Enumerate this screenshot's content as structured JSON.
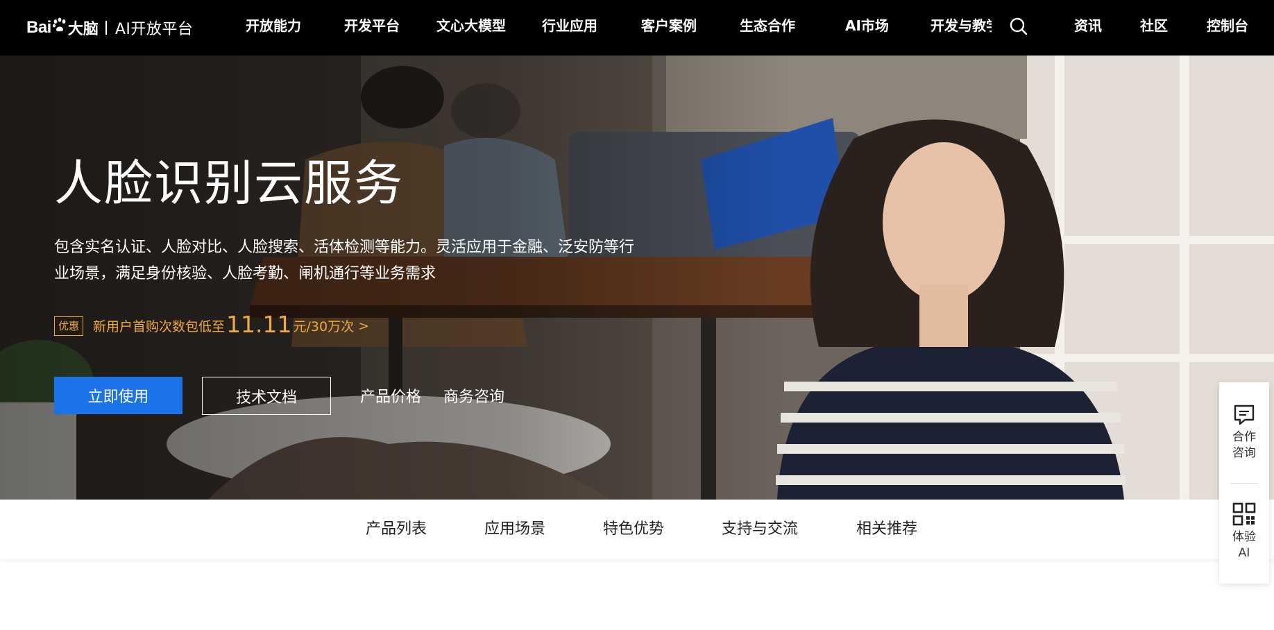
{
  "brand": {
    "bai": "Bai",
    "du": "大脑",
    "platform": "AI开放平台"
  },
  "nav": {
    "items": [
      "开放能力",
      "开发平台",
      "文心大模型",
      "行业应用",
      "客户案例",
      "生态合作",
      "AI市场",
      "开发与教学"
    ],
    "right_items": [
      "资讯",
      "社区",
      "控制台"
    ],
    "search_icon": "search-icon"
  },
  "hero": {
    "title": "人脸识别云服务",
    "description_line1": "包含实名认证、人脸对比、人脸搜索、活体检测等能力。灵活应用于金融、泛安防等行",
    "description_line2": "业场景，满足身份核验、人脸考勤、闸机通行等业务需求",
    "promo_badge": "优惠",
    "promo_text": "新用户首购次数包低至",
    "promo_price": "11.11",
    "promo_unit": "元/30万次",
    "promo_arrow": ">",
    "btn_primary": "立即使用",
    "btn_outline": "技术文档",
    "link_price": "产品价格",
    "link_consult": "商务咨询"
  },
  "subnav": {
    "items": [
      "产品列表",
      "应用场景",
      "特色优势",
      "支持与交流",
      "相关推荐"
    ]
  },
  "float_panel": {
    "consult_label_1": "合作",
    "consult_label_2": "咨询",
    "try_label_1": "体验",
    "try_label_2": "AI"
  },
  "colors": {
    "primary_blue": "#1a73e8",
    "promo_orange": "#f2a93b",
    "nav_bg": "#000000"
  }
}
